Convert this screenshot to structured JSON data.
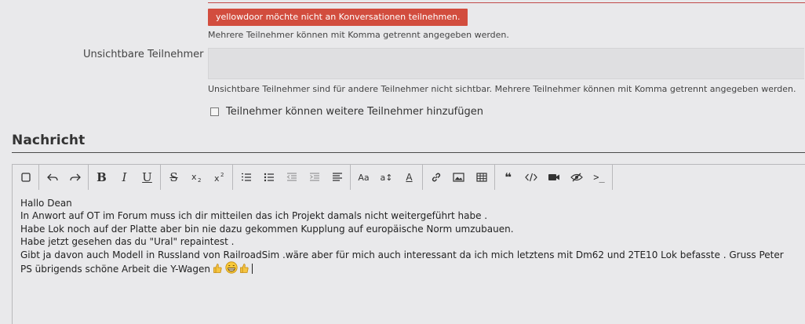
{
  "recipients": {
    "error_message": "yellowdoor möchte nicht an Konversationen teilnehmen.",
    "hint": "Mehrere Teilnehmer können mit Komma getrennt angegeben werden."
  },
  "invisible_recipients": {
    "label": "Unsichtbare Teilnehmer",
    "value": "",
    "hint": "Unsichtbare Teilnehmer sind für andere Teilnehmer nicht sichtbar. Mehrere Teilnehmer können mit Komma getrennt angegeben werden."
  },
  "invite_option": {
    "label": "Teilnehmer können weitere Teilnehmer hinzufügen",
    "checked": false
  },
  "message_section": {
    "title": "Nachricht"
  },
  "toolbar": {
    "groups": [
      [
        "toggle-bbcode-icon"
      ],
      [
        "undo-icon",
        "redo-icon"
      ],
      [
        "bold-icon",
        "italic-icon",
        "underline-icon"
      ],
      [
        "strikethrough-icon",
        "subscript-icon",
        "superscript-icon"
      ],
      [
        "ordered-list-icon",
        "unordered-list-icon",
        "outdent-icon",
        "indent-icon",
        "align-icon"
      ],
      [
        "font-family-icon",
        "font-size-icon",
        "font-color-icon"
      ],
      [
        "link-icon",
        "image-icon",
        "table-icon"
      ],
      [
        "quote-icon",
        "code-icon",
        "media-icon",
        "spoiler-icon",
        "inline-code-icon"
      ]
    ],
    "labels": {
      "bold": "B",
      "italic": "I",
      "underline": "U",
      "strikethrough": "S",
      "font_family": "Aa",
      "font_size": "a↕",
      "font_color": "A",
      "inline_code": ">_",
      "quote": "❝"
    }
  },
  "message": {
    "lines": [
      "Hallo Dean",
      "In Anwort auf OT im Forum muss ich dir mitteilen das ich Projekt damals nicht weitergeführt habe .",
      "Habe Lok noch auf der Platte aber bin nie dazu gekommen Kupplung auf europäische Norm umzubauen.",
      "Habe jetzt gesehen das du \"Ural\" repaintest .",
      "Gibt ja davon auch Modell in Russland von RailroadSim .wäre aber für mich auch interessant da ich mich letztens mit Dm62 und 2TE10 Lok befasste . Gruss Peter",
      "PS übrigends schöne Arbeit die Y-Wagen"
    ],
    "emojis": [
      "thumbs-up-icon",
      "grinning-face-icon",
      "thumbs-up-icon"
    ]
  }
}
